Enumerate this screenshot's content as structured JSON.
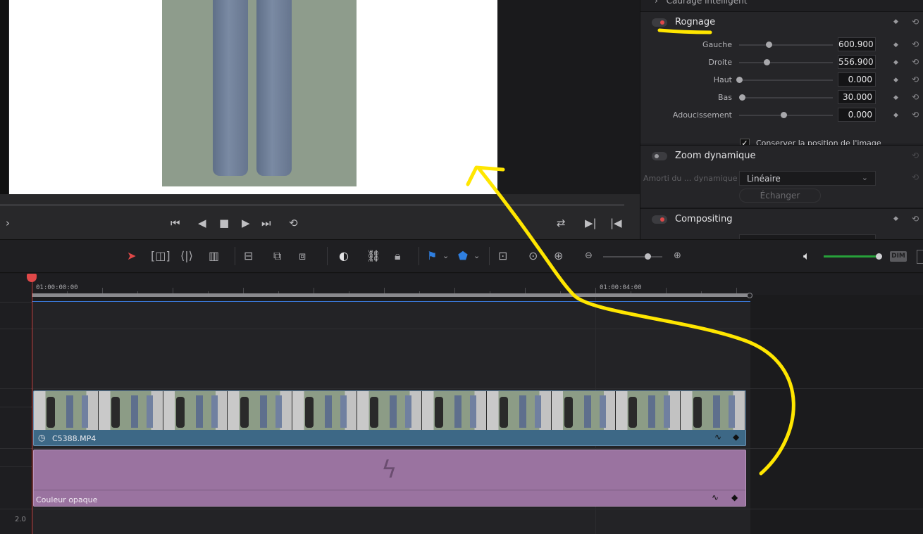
{
  "inspector": {
    "top_section_partial": "Cadrage intelligent",
    "crop": {
      "title": "Rognage",
      "params": [
        {
          "label": "Gauche",
          "value": "600.900",
          "knob": 0.33
        },
        {
          "label": "Droite",
          "value": "556.900",
          "knob": 0.31
        },
        {
          "label": "Haut",
          "value": "0.000",
          "knob": 0.0
        },
        {
          "label": "Bas",
          "value": "30.000",
          "knob": 0.03
        },
        {
          "label": "Adoucissement",
          "value": "0.000",
          "knob": 0.5
        }
      ],
      "keep_position_label": "Conserver la position de l'image",
      "keep_position_checked": true
    },
    "dynamic_zoom": {
      "title": "Zoom dynamique",
      "ease_label": "Amorti du ... dynamique",
      "ease_value": "Linéaire",
      "swap_label": "Échanger"
    },
    "compositing": {
      "title": "Compositing"
    }
  },
  "timeline": {
    "timecode_start": "01:00:00:00",
    "timecode_mid": "01:00:04:00",
    "track_scale": "2.0",
    "video_clip_name": "C5388.MP4",
    "solid_clip_name": "Couleur opaque"
  },
  "colors": {
    "accent_red": "#e04848",
    "video_clip": "#3d6886",
    "solid_clip": "#9a73a0",
    "volume_green": "#27a13a",
    "annotation_yellow": "#ffe600"
  },
  "toolbar": {
    "dim_label": "DIM",
    "zoom_level": 0.72,
    "volume_level": 0.95
  }
}
